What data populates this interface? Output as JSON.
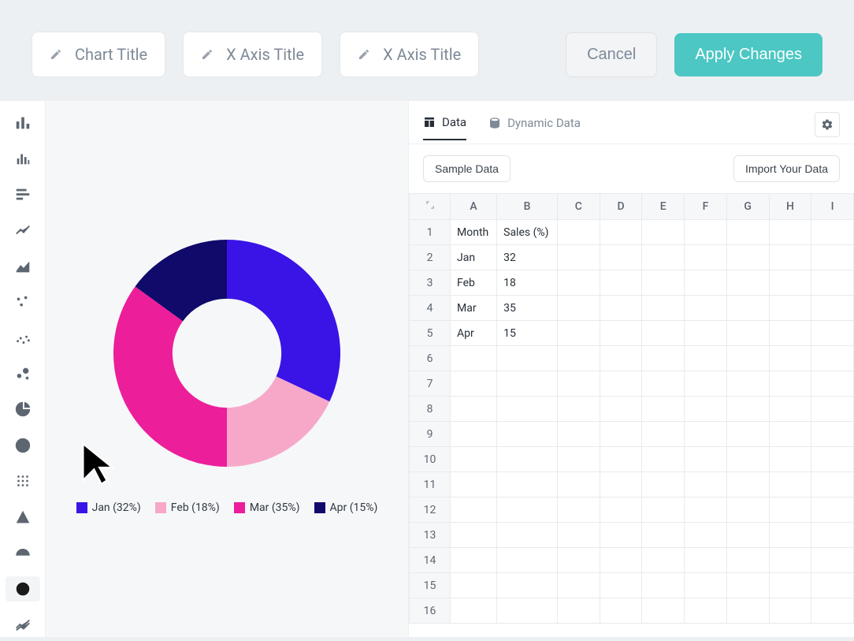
{
  "toolbar": {
    "chart_title_placeholder": "Chart Title",
    "x_axis_placeholder": "X Axis Title",
    "y_axis_placeholder": "X Axis Title",
    "cancel": "Cancel",
    "apply": "Apply Changes"
  },
  "rail": {
    "items": [
      "bar-chart-icon",
      "column-chart-icon",
      "horizontal-bar-icon",
      "line-chart-icon",
      "area-chart-icon",
      "scatter-sparse-icon",
      "scatter-dense-icon",
      "bubble-chart-icon",
      "pie-chart-icon",
      "donut-chart-icon",
      "grid-chart-icon",
      "pyramid-chart-icon",
      "gauge-chart-icon",
      "ring-chart-icon",
      "trend-chart-icon"
    ],
    "selected": "ring-chart-icon"
  },
  "tabs": {
    "data": "Data",
    "dynamic": "Dynamic Data"
  },
  "data_toolbar": {
    "sample": "Sample Data",
    "import": "Import Your Data"
  },
  "spreadsheet": {
    "columns": [
      "A",
      "B",
      "C",
      "D",
      "E",
      "F",
      "G",
      "H",
      "I"
    ],
    "rows": [
      {
        "n": "1",
        "A": "Month",
        "B": "Sales (%)"
      },
      {
        "n": "2",
        "A": "Jan",
        "B": "32"
      },
      {
        "n": "3",
        "A": "Feb",
        "B": "18"
      },
      {
        "n": "4",
        "A": "Mar",
        "B": "35"
      },
      {
        "n": "5",
        "A": "Apr",
        "B": "15"
      },
      {
        "n": "6"
      },
      {
        "n": "7"
      },
      {
        "n": "8"
      },
      {
        "n": "9"
      },
      {
        "n": "10"
      },
      {
        "n": "11"
      },
      {
        "n": "12"
      },
      {
        "n": "13"
      },
      {
        "n": "14"
      },
      {
        "n": "15"
      },
      {
        "n": "16"
      }
    ]
  },
  "chart_data": {
    "type": "pie",
    "title": "",
    "series_name": "Sales (%)",
    "categories": [
      "Jan",
      "Feb",
      "Mar",
      "Apr"
    ],
    "values": [
      32,
      18,
      35,
      15
    ],
    "colors": [
      "#3a13e6",
      "#f7a8c9",
      "#ec1e9a",
      "#100a6b"
    ],
    "legend": [
      "Jan (32%)",
      "Feb (18%)",
      "Mar (35%)",
      "Apr (15%)"
    ],
    "donut_hole": 0.48
  }
}
